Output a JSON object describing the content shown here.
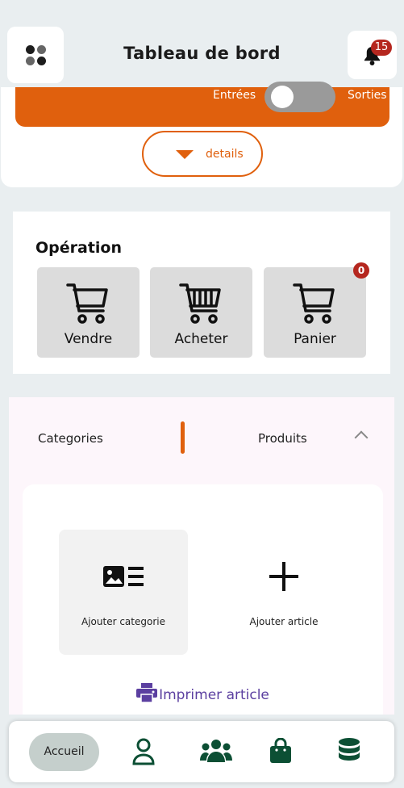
{
  "header": {
    "title": "Tableau de bord",
    "notification_count": "15"
  },
  "summary": {
    "toggle_left_label": "Entrées",
    "toggle_right_label": "Sorties",
    "details_label": "details"
  },
  "operation": {
    "title": "Opération",
    "tiles": [
      {
        "label": "Vendre",
        "icon": "cart-icon"
      },
      {
        "label": "Acheter",
        "icon": "cart-full-icon"
      },
      {
        "label": "Panier",
        "icon": "cart-icon"
      }
    ],
    "cart_count": "0"
  },
  "catalog": {
    "tab_categories": "Categories",
    "tab_products": "Produits",
    "actions": [
      {
        "label": "Ajouter categorie",
        "icon": "image-list-icon"
      },
      {
        "label": "Ajouter article",
        "icon": "plus-icon"
      }
    ],
    "print_label": "Imprimer article"
  },
  "nav": {
    "home_label": "Accueil",
    "items": [
      "user-icon",
      "users-icon",
      "shopping-bag-icon",
      "database-icon"
    ]
  },
  "colors": {
    "accent": "#e0600d",
    "nav_green": "#0c4f34",
    "badge_red": "#b5271f",
    "print_purple": "#5b3fa0"
  }
}
